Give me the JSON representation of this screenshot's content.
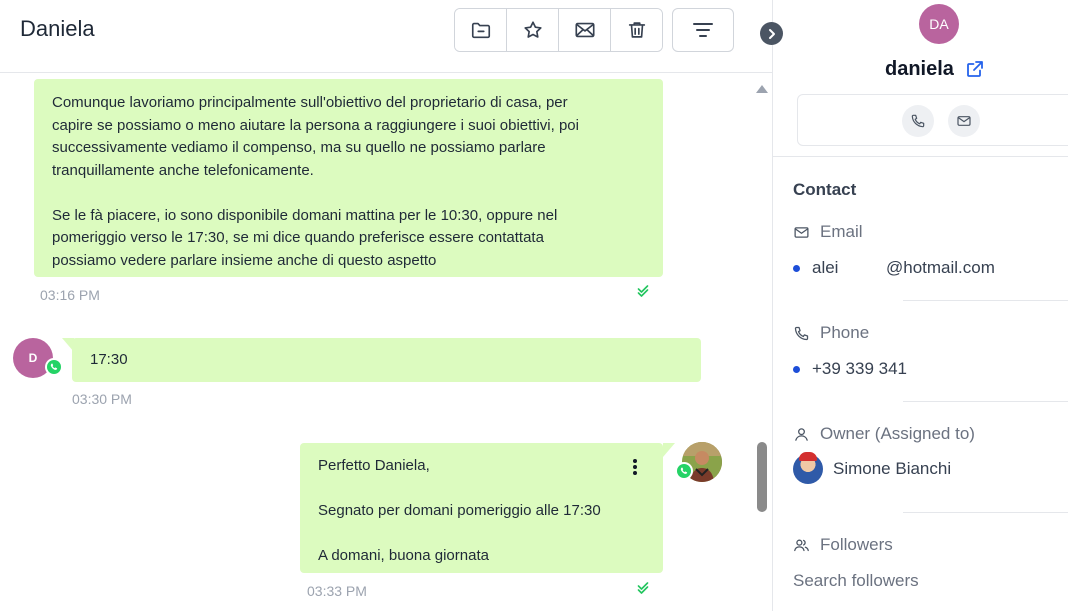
{
  "header": {
    "contact_name": "Daniela",
    "toolbar": [
      {
        "name": "folder-button",
        "icon": "folder-minus-icon"
      },
      {
        "name": "star-button",
        "icon": "star-icon"
      },
      {
        "name": "mail-button",
        "icon": "mail-icon"
      },
      {
        "name": "delete-button",
        "icon": "trash-icon"
      }
    ],
    "filter_icon": "filter-lines-icon",
    "collapse_icon": "chevron-right-icon"
  },
  "messages": [
    {
      "direction": "inbound-continuation",
      "text": "Comunque lavoriamo principalmente sull'obiettivo del proprietario di casa, per\ncapire se possiamo o meno aiutare la persona a raggiungere i suoi obiettivi, poi\nsuccessivamente vediamo il compenso, ma su quello ne possiamo parlare\ntranquillamente anche telefonicamente.\n\nSe le fà piacere, io sono disponibile domani mattina per le 10:30, oppure nel\npomeriggio verso le 17:30, se mi dice quando preferisce essere contattata\npossiamo vedere parlare insieme anche di questo aspetto",
      "time": "03:16 PM",
      "status": "delivered"
    },
    {
      "direction": "inbound",
      "avatar_initial": "D",
      "channel": "whatsapp",
      "text": "17:30",
      "time": "03:30 PM"
    },
    {
      "direction": "outbound",
      "channel": "whatsapp",
      "text": "Perfetto Daniela,\n\nSegnato per domani pomeriggio alle 17:30\n\nA domani, buona giornata",
      "time": "03:33 PM",
      "status": "delivered"
    }
  ],
  "sidebar": {
    "avatar_initials": "DA",
    "name": "daniela",
    "section_title": "Contact",
    "email_label": "Email",
    "email_user": "alei",
    "email_domain": "@hotmail.com",
    "phone_label": "Phone",
    "phone_value": "+39 339 341",
    "owner_label": "Owner (Assigned to)",
    "owner_name": "Simone Bianchi",
    "followers_label": "Followers",
    "search_followers": "Search followers"
  },
  "colors": {
    "bubble": "#dcfbbf",
    "avatar": "#b9649e",
    "whatsapp": "#25d366",
    "check": "#22c55e",
    "link": "#2563eb"
  }
}
